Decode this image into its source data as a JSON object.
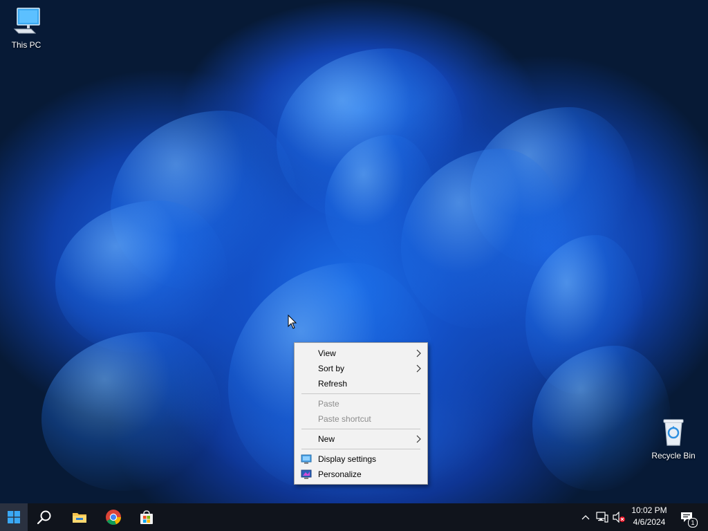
{
  "desktop": {
    "icons": [
      {
        "label": "This PC",
        "icon": "computer-icon"
      },
      {
        "label": "Recycle Bin",
        "icon": "recycle-bin-icon"
      }
    ]
  },
  "context_menu": {
    "items": [
      {
        "label": "View",
        "submenu": true,
        "enabled": true
      },
      {
        "label": "Sort by",
        "submenu": true,
        "enabled": true
      },
      {
        "label": "Refresh",
        "submenu": false,
        "enabled": true
      },
      {
        "label": "Paste",
        "submenu": false,
        "enabled": false
      },
      {
        "label": "Paste shortcut",
        "submenu": false,
        "enabled": false
      },
      {
        "label": "New",
        "submenu": true,
        "enabled": true
      },
      {
        "label": "Display settings",
        "icon": "display-settings-icon",
        "enabled": true
      },
      {
        "label": "Personalize",
        "icon": "personalize-icon",
        "enabled": true
      }
    ]
  },
  "taskbar": {
    "pinned": [
      "start-icon",
      "search-icon",
      "file-explorer-icon",
      "chrome-icon",
      "microsoft-store-icon"
    ],
    "tray": {
      "icons": [
        "chevron-up-icon",
        "network-icon",
        "volume-muted-icon"
      ],
      "time": "10:02 PM",
      "date": "4/6/2024",
      "notification_count": "1"
    }
  },
  "colors": {
    "taskbar_bg": "#10141c",
    "menu_bg": "#f2f2f2",
    "disabled_text": "#8c8c8c",
    "accent": "#0078d4"
  }
}
